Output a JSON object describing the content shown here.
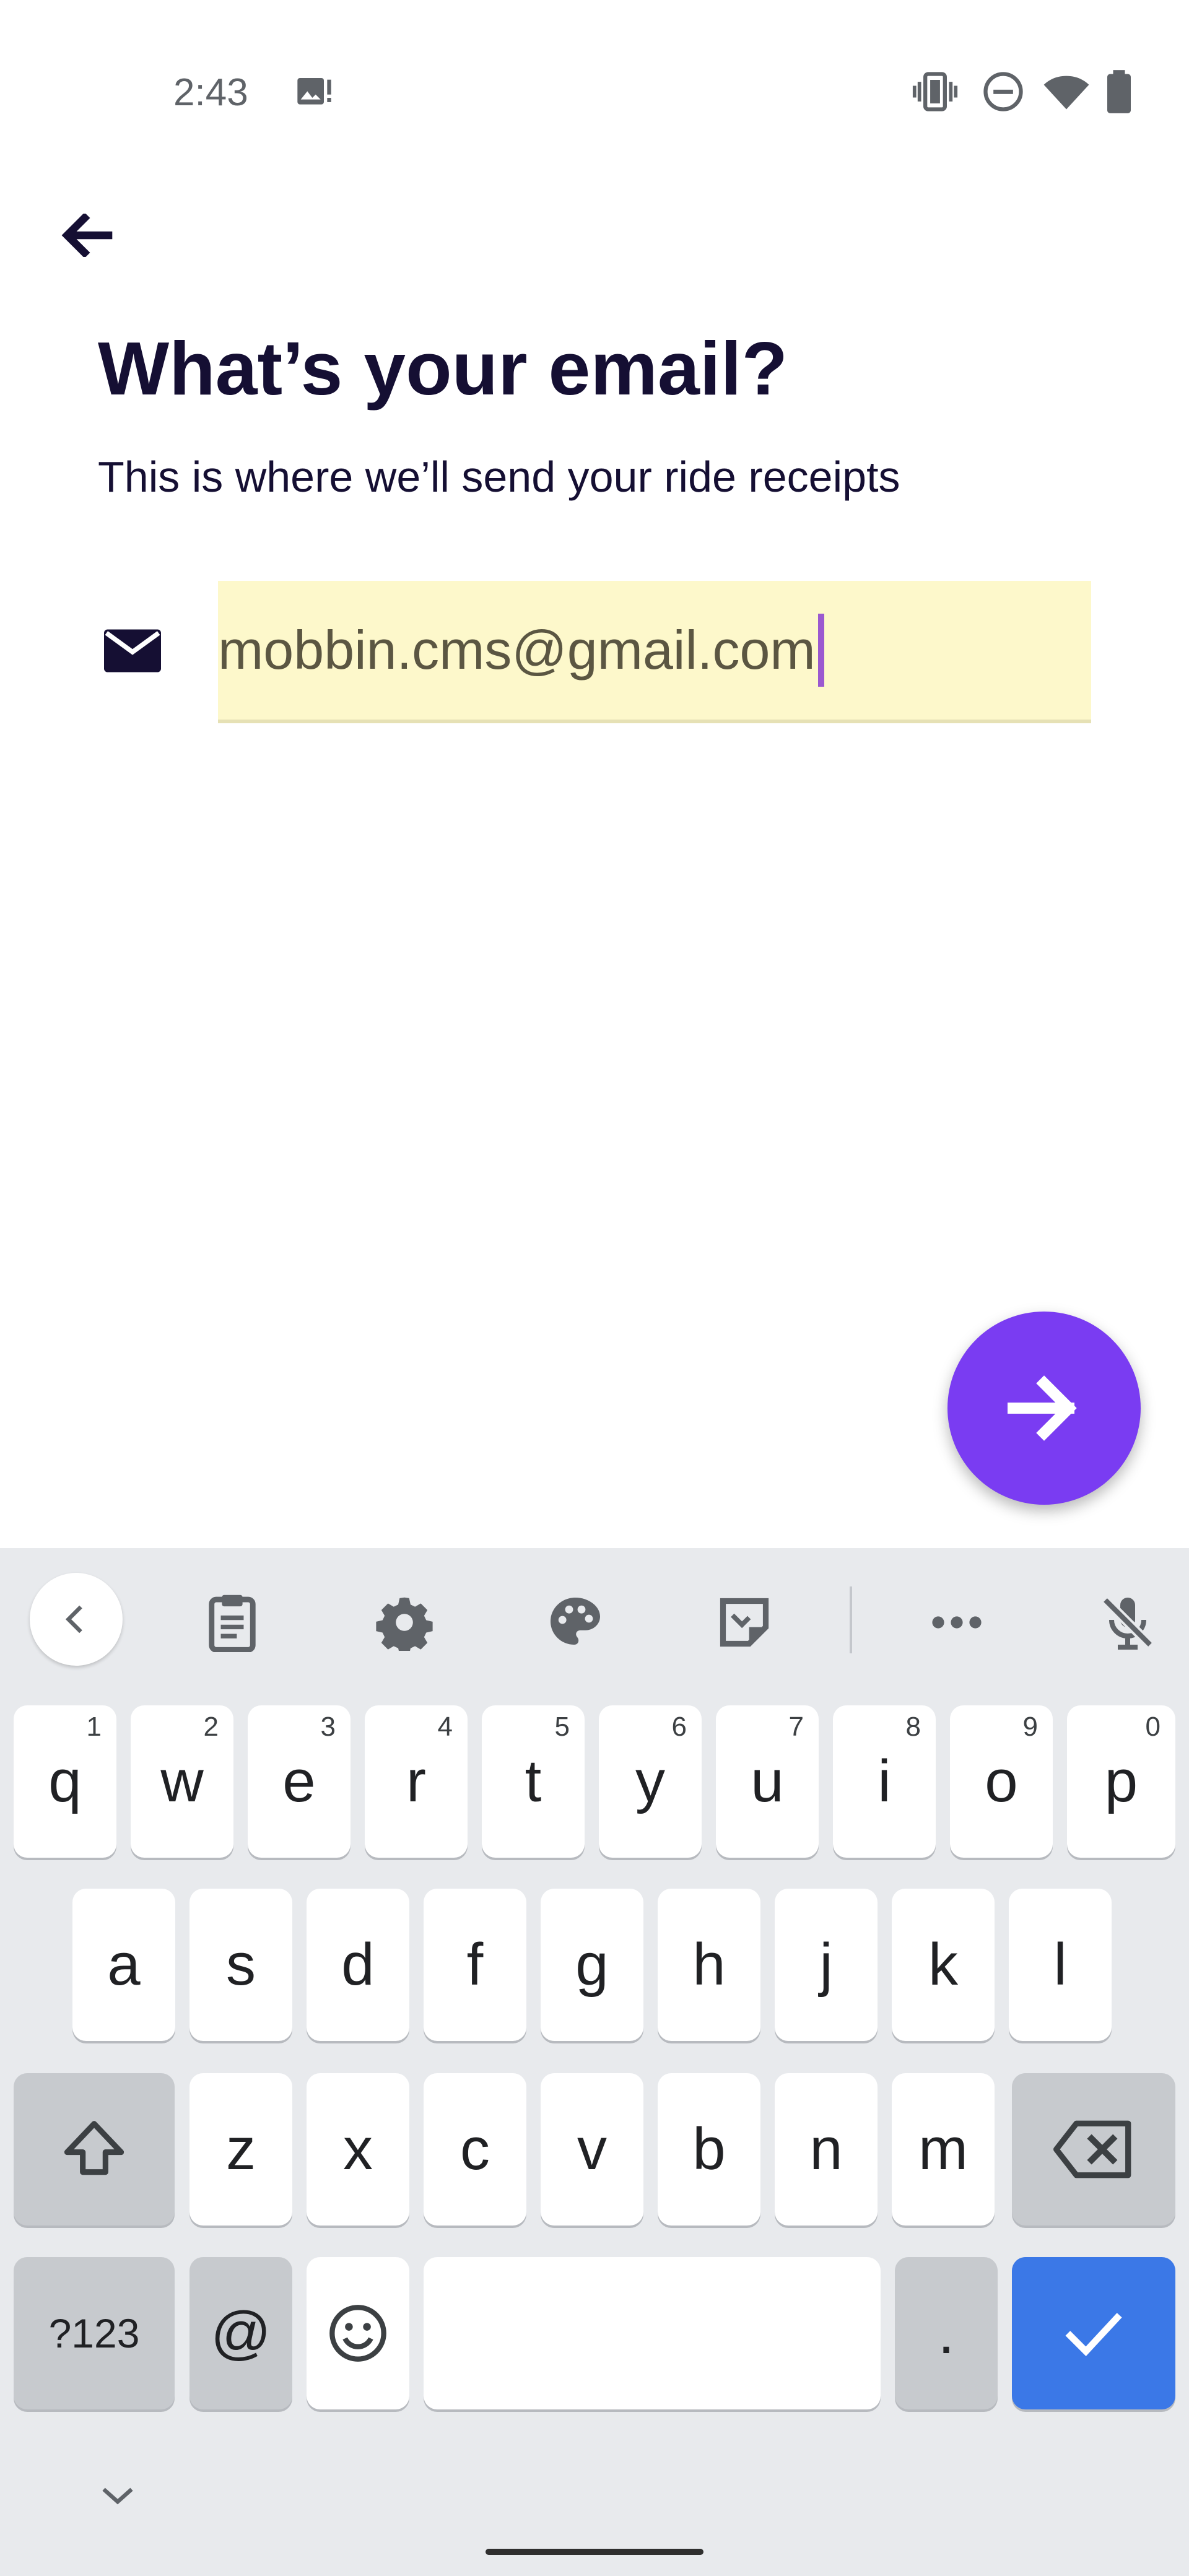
{
  "status_bar": {
    "time": "2:43",
    "icons": [
      "image-alert-icon",
      "vibrate-icon",
      "do-not-disturb-icon",
      "wifi-icon",
      "battery-icon"
    ]
  },
  "header": {
    "back_icon": "arrow-left-icon",
    "title": "What’s your email?",
    "subtitle": "This is where we’ll send your ride receipts"
  },
  "email_field": {
    "icon": "mail-icon",
    "value": "mobbin.cms@gmail.com"
  },
  "fab": {
    "icon": "arrow-right-icon",
    "color": "#7a3cf2"
  },
  "keyboard": {
    "toolbar": [
      "chevron-left-icon",
      "clipboard-icon",
      "gear-icon",
      "palette-icon",
      "sticker-icon",
      "more-icon",
      "mic-off-icon"
    ],
    "row1": [
      {
        "key": "q",
        "hint": "1"
      },
      {
        "key": "w",
        "hint": "2"
      },
      {
        "key": "e",
        "hint": "3"
      },
      {
        "key": "r",
        "hint": "4"
      },
      {
        "key": "t",
        "hint": "5"
      },
      {
        "key": "y",
        "hint": "6"
      },
      {
        "key": "u",
        "hint": "7"
      },
      {
        "key": "i",
        "hint": "8"
      },
      {
        "key": "o",
        "hint": "9"
      },
      {
        "key": "p",
        "hint": "0"
      }
    ],
    "row2": [
      "a",
      "s",
      "d",
      "f",
      "g",
      "h",
      "j",
      "k",
      "l"
    ],
    "row3": [
      "z",
      "x",
      "c",
      "v",
      "b",
      "n",
      "m"
    ],
    "row4": {
      "symbols": "?123",
      "at": "@",
      "period": "."
    },
    "accent_color": "#3b78e7"
  }
}
